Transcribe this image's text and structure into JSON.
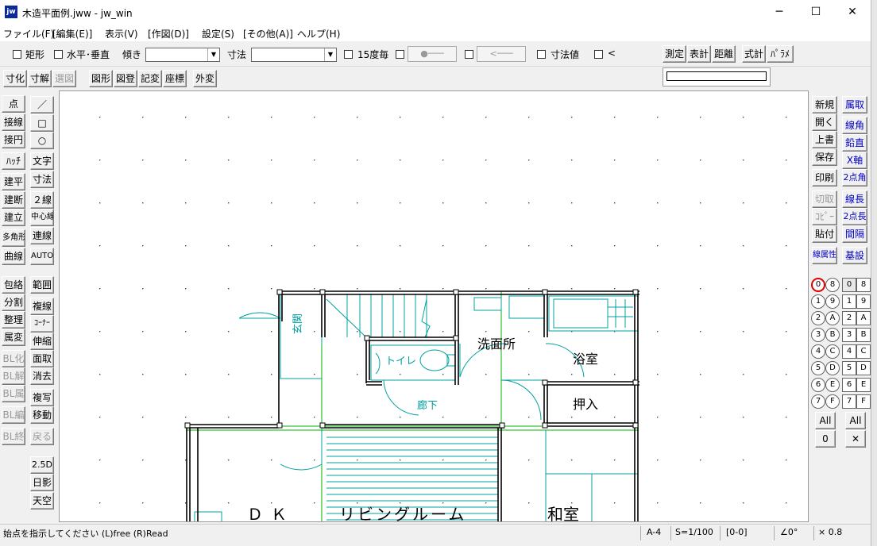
{
  "window": {
    "title": "木造平面例.jww - jw_win",
    "app_icon": "jw",
    "minimize": "─",
    "maximize": "☐",
    "close": "✕"
  },
  "menu": [
    "ファイル(F)",
    "[編集(E)]",
    "表示(V)",
    "[作図(D)]",
    "設定(S)",
    "[その他(A)]",
    "ヘルプ(H)"
  ],
  "toolbar1": {
    "rect_label": "矩形",
    "hv_label": "水平･垂直",
    "tilt_label": "傾き",
    "tilt_value": "",
    "dim_label": "寸法",
    "dim_value": "",
    "deg15_label": "15度毎",
    "dot_line": "●───",
    "arrow_line": "<───",
    "dimval_label": "寸法値",
    "lt_label": "<",
    "measure": "測定",
    "table_calc": "表計",
    "distance": "距離",
    "formula_calc": "式計",
    "params": "ﾊﾟﾗﾒ"
  },
  "toolbar2": [
    "寸化",
    "寸解",
    "選図",
    "図形",
    "図登",
    "記変",
    "座標",
    "外変"
  ],
  "left_tools": {
    "col1": [
      "点",
      "接線",
      "接円",
      "ﾊｯﾁ",
      "建平",
      "建断",
      "建立",
      "多角形",
      "曲線",
      "包絡",
      "分割",
      "整理",
      "属変",
      "BL化",
      "BL解",
      "BL属",
      "BL編",
      "BL終"
    ],
    "col2": [
      "／",
      "□",
      "○",
      "文字",
      "寸法",
      "２線",
      "中心線",
      "連線",
      "AUTO",
      "範囲",
      "複線",
      "ｺｰﾅｰ",
      "伸縮",
      "面取",
      "消去",
      "複写",
      "移動",
      "戻る",
      "2.5D",
      "日影",
      "天空"
    ]
  },
  "right_tools": {
    "col1": [
      "新規",
      "開く",
      "上書",
      "保存",
      "印刷",
      "切取",
      "ｺﾋﾟｰ",
      "貼付",
      "線属性"
    ],
    "col2": [
      "属取",
      "線角",
      "鉛直",
      "X軸",
      "2点角",
      "線長",
      "2点長",
      "間隔",
      "基設"
    ]
  },
  "layers": {
    "group_ids": [
      "0",
      "1",
      "2",
      "3",
      "4",
      "5",
      "6",
      "7",
      "8",
      "9",
      "A",
      "B",
      "C",
      "D",
      "E",
      "F"
    ],
    "layer_ids": [
      "0",
      "1",
      "2",
      "3",
      "4",
      "5",
      "6",
      "7",
      "8",
      "9",
      "A",
      "B",
      "C",
      "D",
      "E",
      "F"
    ],
    "all_label": "All",
    "zero_label": "0",
    "x_label": "✕"
  },
  "drawing": {
    "rooms": [
      "玄関",
      "トイレ",
      "洗面所",
      "浴室",
      "廊下",
      "押入",
      "ＤＫ",
      "リビングルーム",
      "和室"
    ],
    "wall_color": "#000000",
    "line_color": "#00a0a0",
    "aux_color": "#00b000"
  },
  "status": {
    "message": "始点を指示してください (L)free (R)Read",
    "paper": "A-4",
    "scale": "S=1/100",
    "layer": "[0-0]",
    "angle": "∠0°",
    "zoom": "× 0.8"
  }
}
